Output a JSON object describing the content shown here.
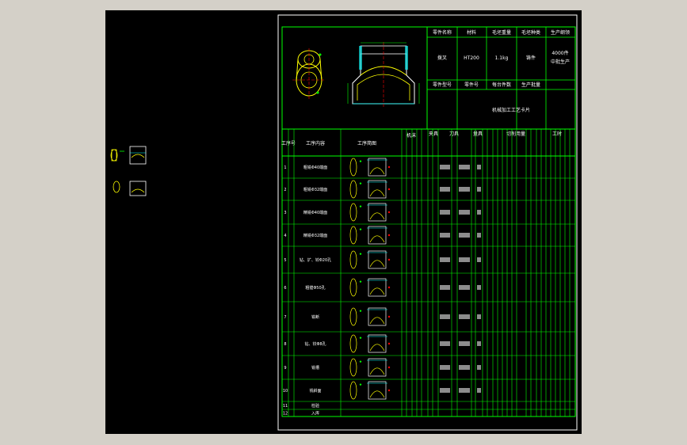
{
  "header": {
    "row1_labels": [
      "零件名称",
      "材料",
      "毛坯重量",
      "毛坯种类",
      "生产纲领"
    ],
    "row1_values": [
      "拨叉",
      "HT200",
      "1.1kg",
      "铸件",
      "4000件"
    ],
    "production_type": "中批生产",
    "row2_labels": [
      "零件型号",
      "零件号",
      "每台件数",
      "生产批量"
    ],
    "process_note": "机械加工工艺卡片"
  },
  "table": {
    "col_headers": [
      "工序号",
      "工序内容",
      "工序简图",
      "机床",
      "夹具",
      "刀具",
      "量具",
      "切削用量",
      "工时"
    ],
    "rows": [
      {
        "no": "1",
        "content": "粗铣Φ40端面"
      },
      {
        "no": "2",
        "content": "粗铣Φ32端面"
      },
      {
        "no": "3",
        "content": "精铣Φ40端面"
      },
      {
        "no": "4",
        "content": "精铣Φ32端面"
      },
      {
        "no": "5",
        "content": "钻、扩、铰Φ20孔"
      },
      {
        "no": "6",
        "content": "粗镗Φ50孔"
      },
      {
        "no": "7",
        "content": "铣断"
      },
      {
        "no": "8",
        "content": "钻、铰Φ8孔"
      },
      {
        "no": "9",
        "content": "铣槽"
      },
      {
        "no": "10",
        "content": "铣斜面"
      },
      {
        "no": "11",
        "content": "检验"
      },
      {
        "no": "12",
        "content": "入库"
      }
    ]
  },
  "colors": {
    "background": "#000000",
    "frame": "#00ff00",
    "text": "#ffffff",
    "part_outline": "#ffff00",
    "dimension": "#00ffff",
    "cut": "#ff0000"
  }
}
